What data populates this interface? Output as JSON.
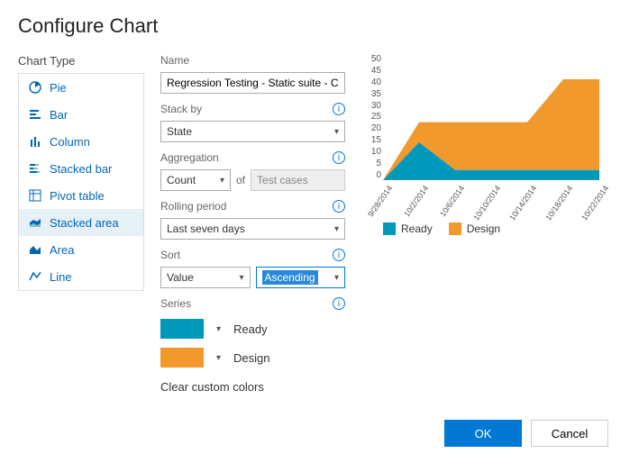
{
  "title": "Configure Chart",
  "sidebar": {
    "heading": "Chart Type",
    "items": [
      {
        "label": "Pie"
      },
      {
        "label": "Bar"
      },
      {
        "label": "Column"
      },
      {
        "label": "Stacked bar"
      },
      {
        "label": "Pivot table"
      },
      {
        "label": "Stacked area"
      },
      {
        "label": "Area"
      },
      {
        "label": "Line"
      }
    ],
    "selected": "Stacked area"
  },
  "form": {
    "name_label": "Name",
    "name_value": "Regression Testing - Static suite - Ch",
    "stackby_label": "Stack by",
    "stackby_value": "State",
    "agg_label": "Aggregation",
    "agg_value": "Count",
    "agg_of": "of",
    "agg_field": "Test cases",
    "rolling_label": "Rolling period",
    "rolling_value": "Last seven days",
    "sort_label": "Sort",
    "sort_field": "Value",
    "sort_dir": "Ascending",
    "series_label": "Series",
    "series": [
      {
        "name": "Ready",
        "color": "#0099bc"
      },
      {
        "name": "Design",
        "color": "#f2992e"
      }
    ],
    "clear": "Clear custom colors"
  },
  "chart_data": {
    "type": "area",
    "title": "",
    "xlabel": "",
    "ylabel": "",
    "ylim": [
      0,
      50
    ],
    "yticks": [
      50,
      45,
      40,
      35,
      30,
      25,
      20,
      15,
      10,
      5,
      0
    ],
    "categories": [
      "9/28/2014",
      "10/2/2014",
      "10/6/2014",
      "10/10/2014",
      "10/14/2014",
      "10/18/2014",
      "10/22/2014"
    ],
    "series": [
      {
        "name": "Ready",
        "color": "#0099bc",
        "values": [
          0,
          15,
          4,
          4,
          4,
          4,
          4
        ]
      },
      {
        "name": "Design",
        "color": "#f2992e",
        "values": [
          0,
          8,
          19,
          19,
          19,
          36,
          36
        ]
      }
    ],
    "legend": [
      "Ready",
      "Design"
    ]
  },
  "footer": {
    "ok": "OK",
    "cancel": "Cancel"
  }
}
